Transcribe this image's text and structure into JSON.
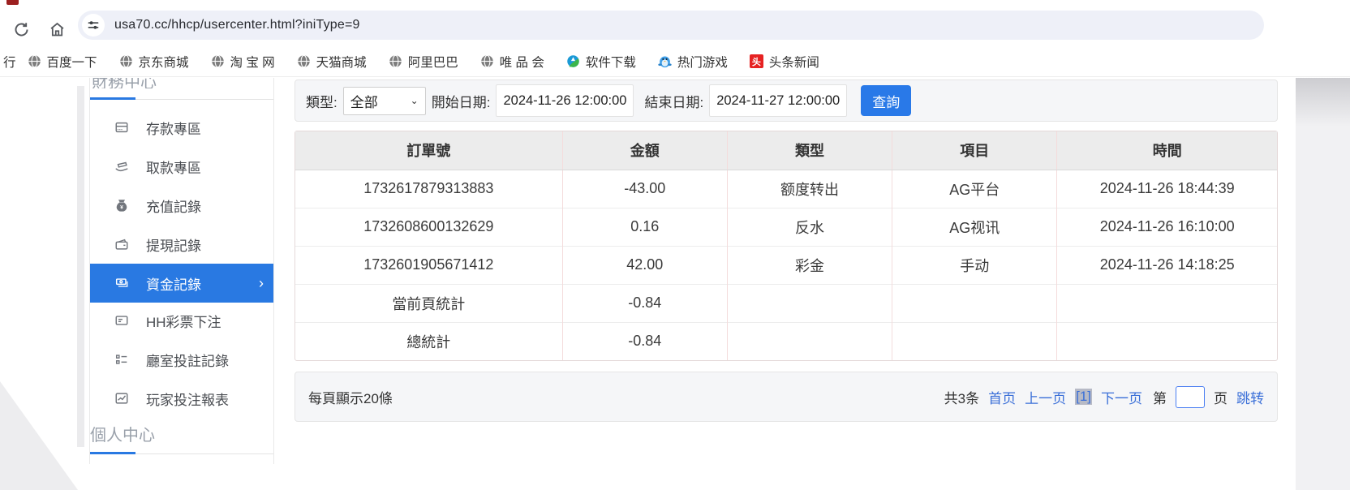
{
  "browser": {
    "url": "usa70.cc/hhcp/usercenter.html?iniType=9",
    "bookmarks": [
      {
        "label": "行",
        "icon": "none"
      },
      {
        "label": "百度一下",
        "icon": "globe"
      },
      {
        "label": "京东商城",
        "icon": "globe"
      },
      {
        "label": "淘 宝 网",
        "icon": "globe"
      },
      {
        "label": "天猫商城",
        "icon": "globe"
      },
      {
        "label": "阿里巴巴",
        "icon": "globe"
      },
      {
        "label": "唯 品 会",
        "icon": "globe"
      },
      {
        "label": "软件下载",
        "icon": "software"
      },
      {
        "label": "热门游戏",
        "icon": "game"
      },
      {
        "label": "头条新闻",
        "icon": "toutiao",
        "badge": "头"
      }
    ]
  },
  "sidebar": {
    "section_top": "財務中心",
    "items": [
      {
        "label": "存款專區"
      },
      {
        "label": "取款專區"
      },
      {
        "label": "充值記錄"
      },
      {
        "label": "提現記錄"
      },
      {
        "label": "資金記錄",
        "selected": true,
        "chevron": "›"
      },
      {
        "label": "HH彩票下注"
      },
      {
        "label": "廳室投註記錄"
      },
      {
        "label": "玩家投注報表"
      }
    ],
    "section_bottom": "個人中心"
  },
  "filters": {
    "type_label": "類型:",
    "type_value": "全部",
    "start_label": "開始日期:",
    "start_value": "2024-11-26 12:00:00",
    "end_label": "結束日期:",
    "end_value": "2024-11-27 12:00:00",
    "search_button": "查詢"
  },
  "table": {
    "headers": [
      "訂單號",
      "金額",
      "類型",
      "項目",
      "時間"
    ],
    "rows": [
      [
        "1732617879313883",
        "-43.00",
        "额度转出",
        "AG平台",
        "2024-11-26 18:44:39"
      ],
      [
        "1732608600132629",
        "0.16",
        "反水",
        "AG视讯",
        "2024-11-26 16:10:00"
      ],
      [
        "1732601905671412",
        "42.00",
        "彩金",
        "手动",
        "2024-11-26 14:18:25"
      ],
      [
        "當前頁統計",
        "-0.84",
        "",
        "",
        ""
      ],
      [
        "總統計",
        "-0.84",
        "",
        "",
        ""
      ]
    ]
  },
  "pagination": {
    "page_size_text": "每頁顯示20條",
    "total_text": "共3条",
    "first_link": "首页",
    "prev_link": "上一页",
    "current_page": "[1]",
    "next_link": "下一页",
    "jump_prefix": "第",
    "jump_value": "",
    "jump_suffix": "页",
    "jump_link": "跳转"
  },
  "colors": {
    "accent_blue": "#2979e8",
    "link_blue": "#3a6fd8",
    "selected_item_bg": "#2979e2",
    "table_header_bg": "#ececec",
    "toutiao_red": "#e62222"
  }
}
